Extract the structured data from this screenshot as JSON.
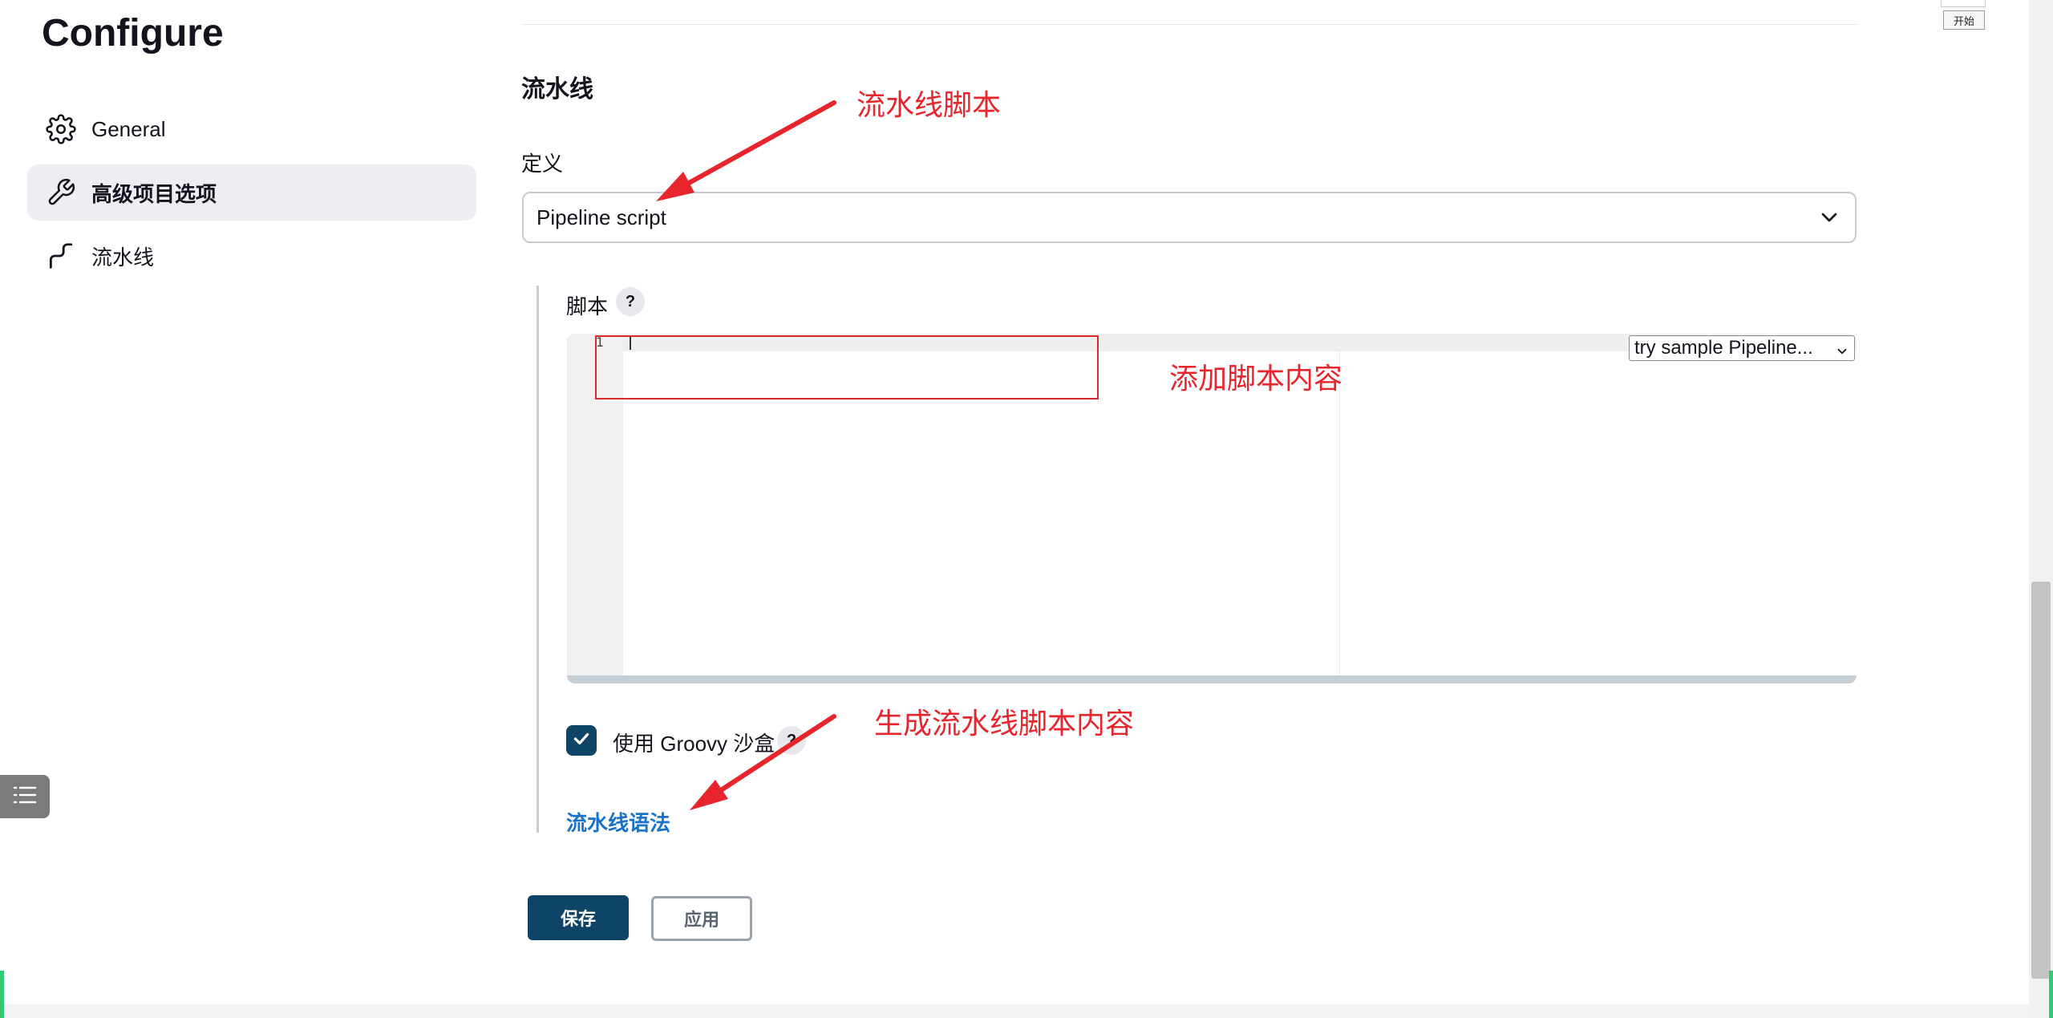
{
  "page": {
    "title": "Configure"
  },
  "sidebar": {
    "items": [
      {
        "label": "General",
        "icon": "gear-icon",
        "active": false
      },
      {
        "label": "高级项目选项",
        "icon": "wrench-icon",
        "active": true
      },
      {
        "label": "流水线",
        "icon": "pipeline-icon",
        "active": false
      }
    ]
  },
  "pipeline": {
    "section_title": "流水线",
    "definition_label": "定义",
    "definition_value": "Pipeline script",
    "script_label": "脚本",
    "help_glyph": "?",
    "line_number": "1",
    "sample_select": "try sample Pipeline...",
    "sandbox_label": "使用 Groovy 沙盒",
    "sandbox_checked": true,
    "syntax_link": "流水线语法"
  },
  "buttons": {
    "save": "保存",
    "apply": "应用"
  },
  "annotations": {
    "pipeline_script": "流水线脚本",
    "add_script": "添加脚本内容",
    "generate_script": "生成流水线脚本内容"
  },
  "browser_widget": {
    "start_label": "开始"
  },
  "colors": {
    "primary": "#0e4466",
    "link": "#1a73c8",
    "annotation": "#e8242c",
    "sidebar_active_bg": "#eceef2"
  }
}
